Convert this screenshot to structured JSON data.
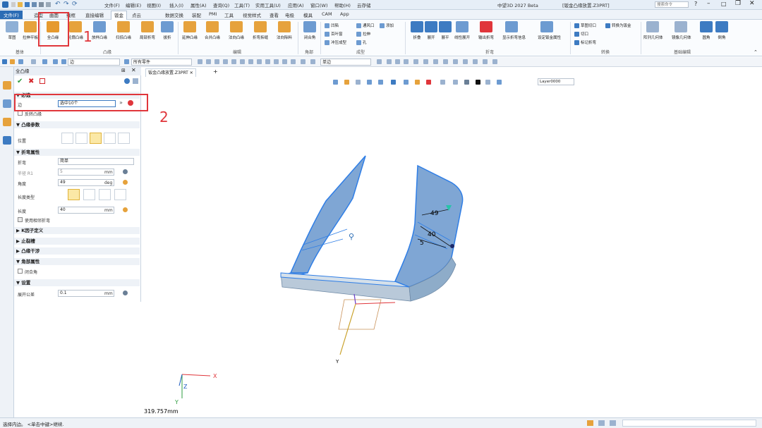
{
  "titlebar": {
    "title": "中望3D 2027 Beta",
    "file": "[钣金凸缘放置.Z3PRT]",
    "search_placeholder": "搜索命令",
    "menu": [
      "文件(F)",
      "编辑(E)",
      "视图(I)",
      "插入(I)",
      "属性(A)",
      "查询(Q)",
      "工具(T)",
      "实用工具(U)",
      "应用(A)",
      "窗口(W)",
      "帮助(H)",
      "云存储"
    ]
  },
  "tabs": [
    "文件(F)",
    "造型",
    "曲面",
    "线框",
    "直接编辑",
    "钣金",
    "点云",
    "数据交换",
    "装配",
    "PMI",
    "工具",
    "视觉样式",
    "查看",
    "电极",
    "模具",
    "CAM",
    "App"
  ],
  "active_tab": "钣金",
  "ribbon": {
    "groups": [
      {
        "label": "基体",
        "buttons": [
          "草图",
          "拉伸平板"
        ]
      },
      {
        "label": "凸缘",
        "buttons": [
          "全凸缘",
          "轮廓凸缘",
          "放样凸缘",
          "扫掠凸缘",
          "局部折弯",
          "拔折"
        ]
      },
      {
        "label": "编辑",
        "buttons": [
          "延伸凸缘",
          "合并凸缘",
          "法向凸缘",
          "折弯拆缝",
          "法向除料"
        ]
      },
      {
        "label": "角部",
        "buttons": [
          "闭合角"
        ]
      },
      {
        "label": "成型",
        "small": [
          "凹陷",
          "百叶窗",
          "冲压成型",
          "通风口",
          "拉伸",
          "孔",
          "添加"
        ]
      },
      {
        "label": "折弯",
        "buttons": [
          "折叠",
          "展开",
          "展平",
          "线性展开",
          "输出折弯",
          "显示折弯信息",
          "设定钣金属性"
        ]
      },
      {
        "label": "转换",
        "small": [
          "草图切口",
          "切口",
          "标记折弯",
          "转换为钣金"
        ]
      },
      {
        "label": "基础编辑",
        "buttons": [
          "阵列几何体",
          "镜像几何体",
          "圆角",
          "倒角"
        ]
      }
    ]
  },
  "toolbar2": {
    "filter": "边",
    "parts": "所有零件",
    "edge_mode": "单边"
  },
  "panel": {
    "title": "全凸缘",
    "sections": {
      "required": "必选",
      "flange_params": "凸缘参数",
      "bend_props": "折弯属性",
      "k_factor": "K因子定义",
      "relief": "止裂槽",
      "interference": "凸缘干涉",
      "corner": "角部属性",
      "settings": "设置"
    },
    "edge_label": "边",
    "edge_value": "选中10个",
    "reverse_label": "反转凸缘",
    "position_label": "位置",
    "bend_type_label": "折弯",
    "bend_type_value": "简单",
    "radius_label": "半径 R1",
    "radius_value": "5",
    "radius_unit": "mm",
    "angle_label": "角度",
    "angle_value": "49",
    "angle_unit": "deg",
    "length_type_label": "长度类型",
    "length_label": "长度",
    "length_value": "40",
    "length_unit": "mm",
    "fix_label": "使用相邻折弯",
    "close_corner_label": "闭合角",
    "unfold_tol_label": "展开公差",
    "unfold_tol_value": "0.1",
    "unfold_tol_unit": "mm"
  },
  "document_tab": "钣金凸缘放置.Z3PRT",
  "view_toolbar": {
    "layer": "Layer0000"
  },
  "viewport": {
    "dim_angle": "49",
    "dim_length": "40",
    "dim_radius": "5",
    "axis_x": "X",
    "axis_y": "Y",
    "axis_z": "Z",
    "scale": "319.757mm"
  },
  "annotations": {
    "one": "1",
    "two": "2"
  },
  "statusbar": {
    "text": "选择内边。 <单击中键>继续."
  },
  "colors": {
    "accent": "#2b6cb5",
    "highlight": "#e0363b",
    "part": "#7fa6d4"
  }
}
